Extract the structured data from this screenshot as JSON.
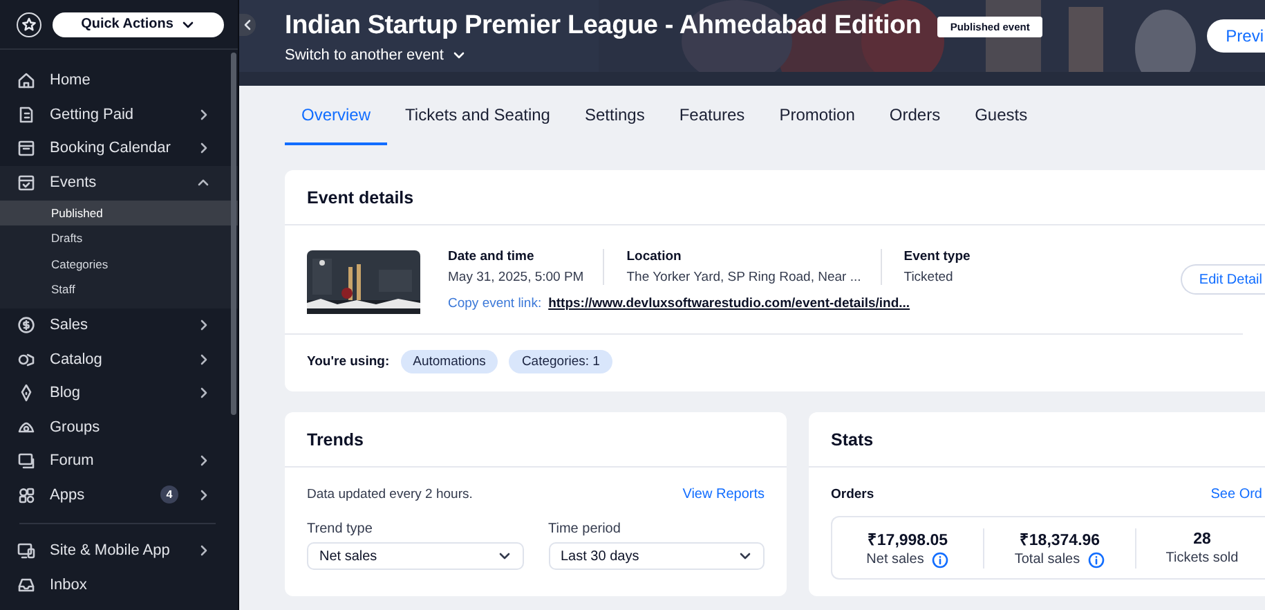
{
  "sidebar": {
    "quick_actions": "Quick Actions",
    "items": [
      {
        "label": "Home",
        "kind": "link"
      },
      {
        "label": "Getting Paid",
        "kind": "submenu"
      },
      {
        "label": "Booking Calendar",
        "kind": "submenu"
      },
      {
        "label": "Events",
        "kind": "group",
        "expanded": true,
        "children": [
          {
            "label": "Published",
            "selected": true
          },
          {
            "label": "Drafts",
            "selected": false
          },
          {
            "label": "Categories",
            "selected": false
          },
          {
            "label": "Staff",
            "selected": false
          }
        ]
      },
      {
        "label": "Sales",
        "kind": "submenu"
      },
      {
        "label": "Catalog",
        "kind": "submenu"
      },
      {
        "label": "Blog",
        "kind": "submenu"
      },
      {
        "label": "Groups",
        "kind": "link"
      },
      {
        "label": "Forum",
        "kind": "submenu"
      },
      {
        "label": "Apps",
        "kind": "submenu",
        "badge": "4"
      },
      {
        "kind": "divider"
      },
      {
        "label": "Site & Mobile App",
        "kind": "submenu"
      },
      {
        "label": "Inbox",
        "kind": "link"
      }
    ]
  },
  "header": {
    "title": "Indian Startup Premier League - Ahmedabad Edition",
    "status": "Published event",
    "switcher": "Switch to another event",
    "preview_button": "Previ"
  },
  "tabs": [
    {
      "label": "Overview",
      "selected": true
    },
    {
      "label": "Tickets and Seating",
      "selected": false
    },
    {
      "label": "Settings",
      "selected": false
    },
    {
      "label": "Features",
      "selected": false
    },
    {
      "label": "Promotion",
      "selected": false
    },
    {
      "label": "Orders",
      "selected": false
    },
    {
      "label": "Guests",
      "selected": false
    }
  ],
  "event_details": {
    "title": "Event details",
    "thumbnail": {
      "kind": "picture"
    },
    "details": [
      {
        "label": "Date and time",
        "value": "May 31, 2025, 5:00 PM"
      },
      {
        "label": "Location",
        "value": "The Yorker Yard, SP Ring Road, Near ..."
      },
      {
        "label": "Event type",
        "value": "Ticketed"
      }
    ],
    "link_label": "Copy event link:",
    "link": "https://www.devluxsoftwarestudio.com/event-details/ind...",
    "edit_button": "Edit Detail",
    "usage_label": "You're using:",
    "usage_tags": [
      "Automations",
      "Categories: 1"
    ]
  },
  "trends": {
    "title": "Trends",
    "note": "Data updated every 2 hours.",
    "link": "View Reports",
    "fields": [
      {
        "label": "Trend type",
        "value": "Net sales"
      },
      {
        "label": "Time period",
        "value": "Last 30 days"
      }
    ]
  },
  "stats": {
    "title": "Stats",
    "section": "Orders",
    "link": "See Ord",
    "metrics": [
      {
        "value": "₹17,998.05",
        "label": "Net sales",
        "info": true
      },
      {
        "value": "₹18,374.96",
        "label": "Total sales",
        "info": true
      },
      {
        "value": "28",
        "label": "Tickets sold",
        "info": false
      }
    ]
  }
}
